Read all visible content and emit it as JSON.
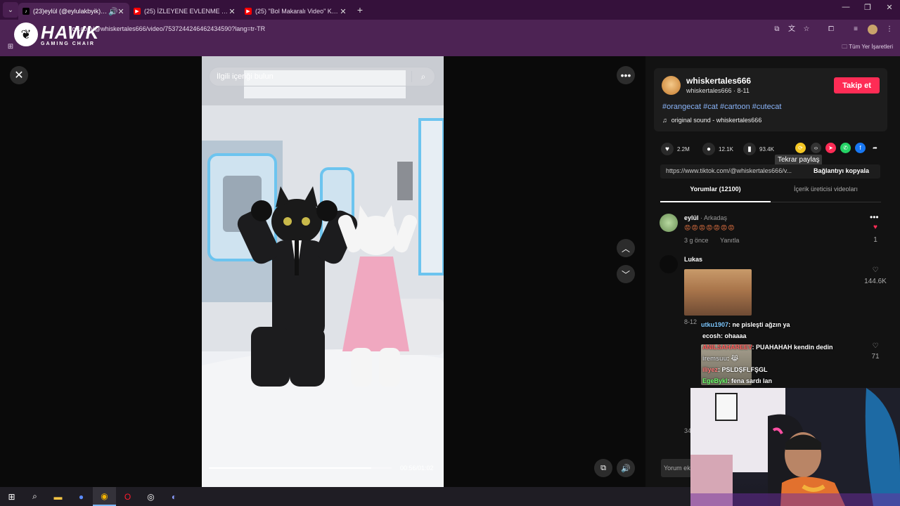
{
  "browser": {
    "tabs": [
      {
        "title": "(23)eylül (@eylulakbyik) | T",
        "active": true,
        "favicon": "tiktok-icon"
      },
      {
        "title": "(25) İZLEYENE EVLENME TEKLİF",
        "active": false,
        "favicon": "youtube-icon"
      },
      {
        "title": "(25) \"Bol Makaralı Video\" Kick",
        "active": false,
        "favicon": "youtube-icon"
      }
    ],
    "url": "tok.com/@whiskertales666/video/7537244246462434590?lang=tr-TR",
    "bookmarks_all": "Tüm Yer İşaretleri"
  },
  "overlay_logo": {
    "main": "HAWK",
    "sub": "GAMING CHAIR"
  },
  "video": {
    "search_placeholder": "İlgili içeriği bulun",
    "progress": 0.89,
    "time": "00:56/01:02"
  },
  "post": {
    "username": "whiskertales666",
    "subline": "whiskertales666 · 8-11",
    "follow_label": "Takip et",
    "hashtags": "#orangecat #cat #cartoon #cutecat",
    "sound": "original sound - whiskertales666",
    "likes": "2.2M",
    "comments": "12.1K",
    "saves": "93.4K",
    "tooltip": "Tekrar paylaş",
    "link": "https://www.tiktok.com/@whiskertales666/v...",
    "copy_label": "Bağlantıyı kopyala"
  },
  "tabs": {
    "comments": "Yorumlar (12100)",
    "creator_videos": "İçerik üreticisi videoları"
  },
  "comments": [
    {
      "name": "eylül",
      "relation": "· Arkadaş",
      "text": "😡😡😡😡😡😡😡",
      "meta": "3 g önce",
      "reply": "Yanıtla",
      "likes": "1"
    },
    {
      "name": "Lukas",
      "meta": "8-12",
      "reply": "Yanıtla",
      "likes": "144.6K"
    }
  ],
  "chat": [
    {
      "user": "utku1907",
      "text": ": ne pisleşti ağzın ya"
    },
    {
      "user": "ecosh",
      "text": ": ohaaaa"
    },
    {
      "user": "ANILSAHAREEV",
      "text": ": PUAHAHAH kendin dedin"
    },
    {
      "user": "iremsuu",
      "text": ": 😹"
    },
    {
      "user": "iliyez",
      "text": ": PSLDŞFLFŞGL"
    },
    {
      "user": "EgeBykl",
      "text": ": fena sardı lan"
    }
  ],
  "chat_likes": "71",
  "partial": {
    "count_left": "34",
    "comment_placeholder": "Yorum ek"
  }
}
